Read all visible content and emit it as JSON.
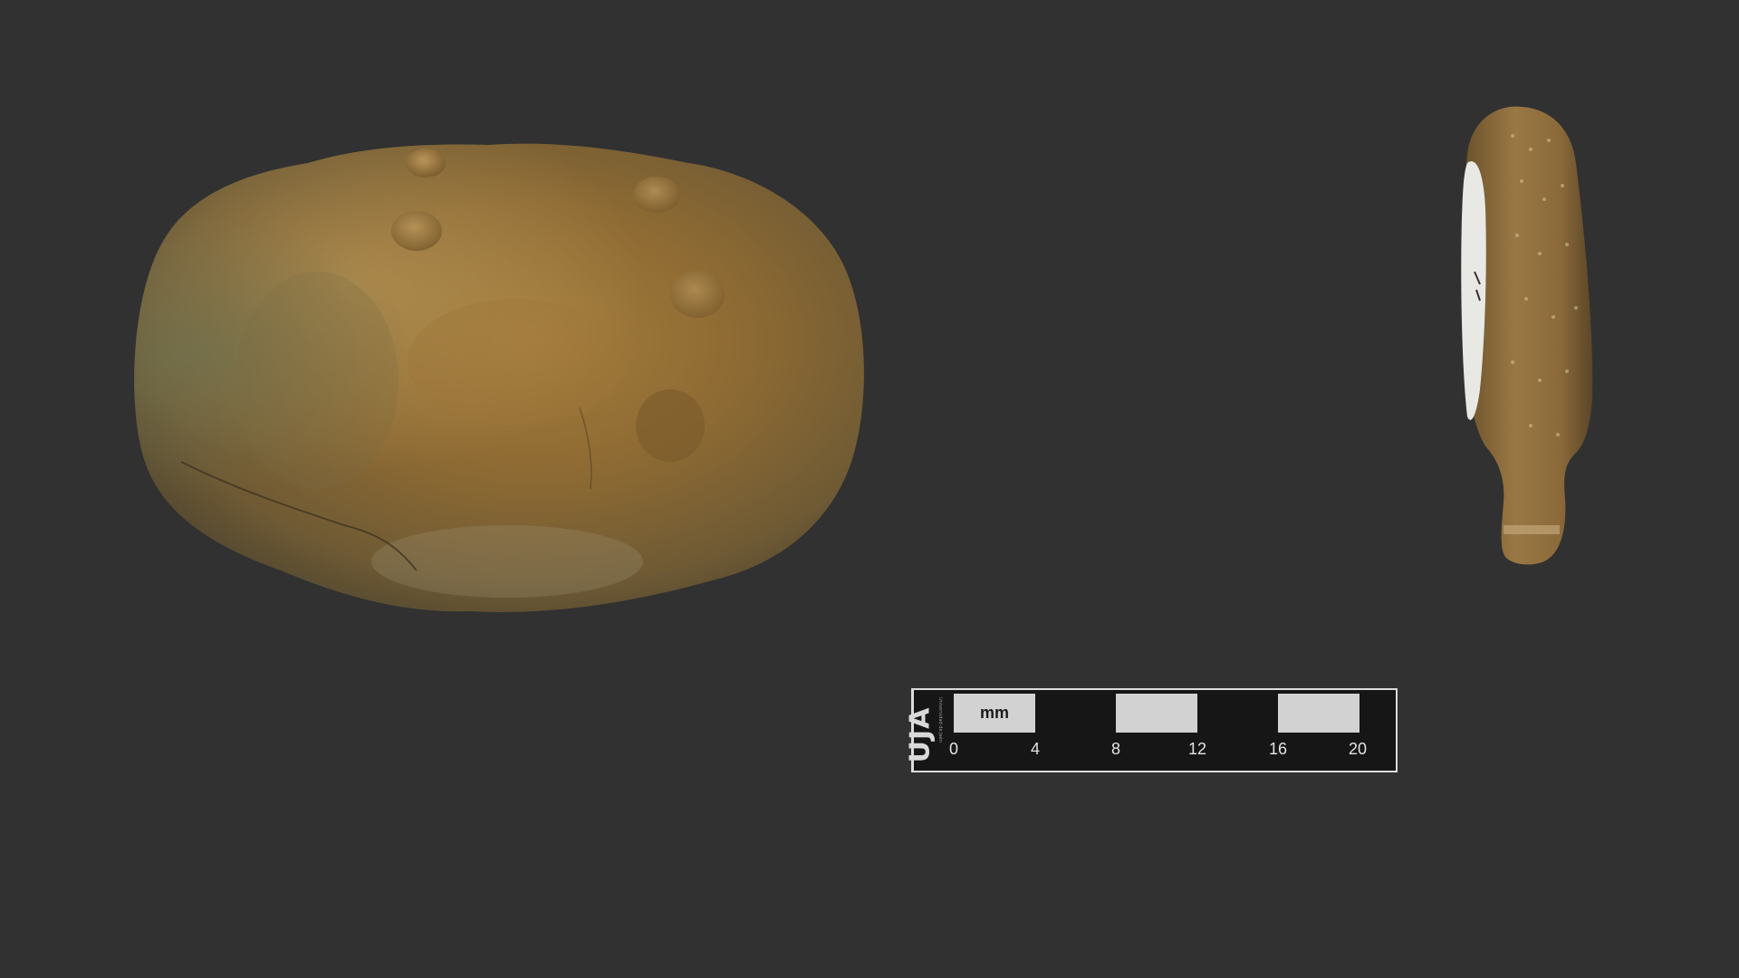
{
  "scale_bar": {
    "unit_label": "mm",
    "ticks": [
      "0",
      "4",
      "8",
      "12",
      "16",
      "20"
    ],
    "logo_text": "UJA",
    "logo_subtext": "Universidad de Jaén"
  },
  "colors": {
    "background": "#313131",
    "fossil_base": "#8a6a32",
    "fossil_light": "#b89a5c",
    "scale_dark": "#161616",
    "scale_light": "#d2d2d2"
  },
  "icons": {
    "fossil_top_view": "fossil-top-view-image",
    "fossil_side_view": "fossil-side-view-image"
  }
}
